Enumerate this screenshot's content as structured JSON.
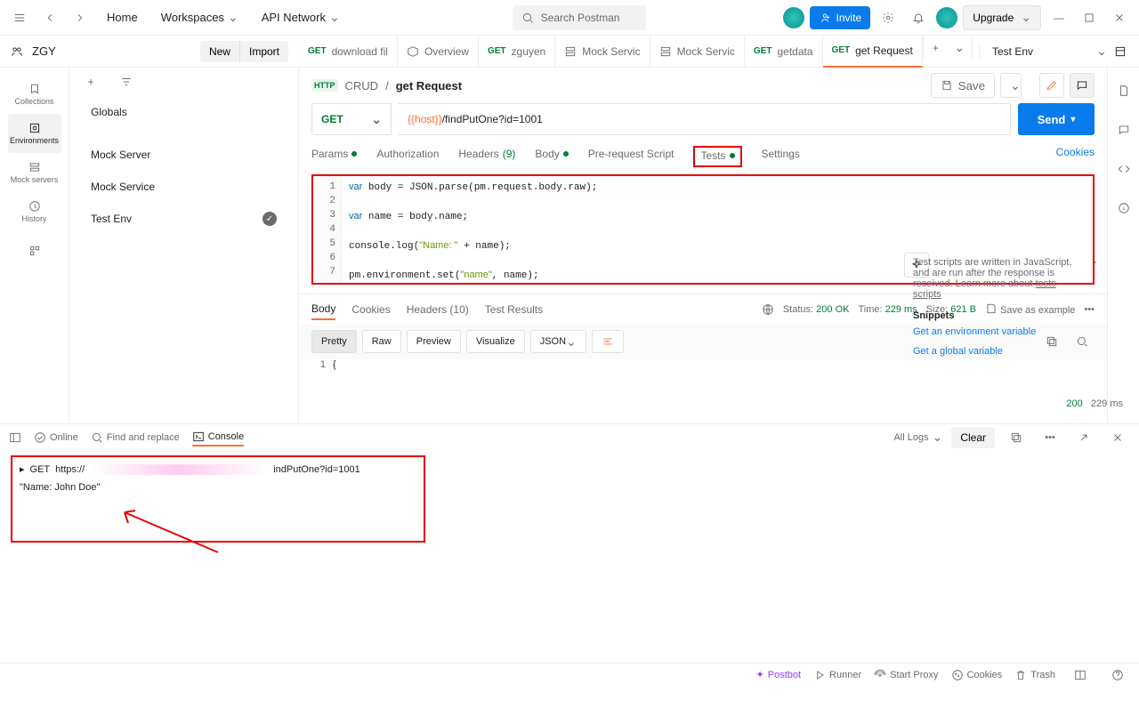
{
  "nav": {
    "home": "Home",
    "workspaces": "Workspaces",
    "apinet": "API Network",
    "search_placeholder": "Search Postman",
    "invite": "Invite",
    "upgrade": "Upgrade"
  },
  "workspace": {
    "name": "ZGY",
    "new": "New",
    "import": "Import",
    "env_label": "Test Env"
  },
  "tabs": [
    {
      "method": "GET",
      "label": "download fil",
      "color": "#007f31"
    },
    {
      "method": "",
      "label": "Overview",
      "color": "#6b6b6b",
      "icon": "folder"
    },
    {
      "method": "GET",
      "label": "zguyen",
      "color": "#007f31"
    },
    {
      "method": "",
      "label": "Mock Servic",
      "icon": "server"
    },
    {
      "method": "",
      "label": "Mock Servic",
      "icon": "server"
    },
    {
      "method": "GET",
      "label": "getdata",
      "color": "#007f31"
    },
    {
      "method": "GET",
      "label": "get Request",
      "color": "#007f31",
      "active": true
    }
  ],
  "rail": {
    "collections": "Collections",
    "environments": "Environments",
    "mock": "Mock servers",
    "history": "History"
  },
  "side": [
    {
      "label": "Globals"
    },
    {
      "label": "Mock Server"
    },
    {
      "label": "Mock Service"
    },
    {
      "label": "Test Env",
      "selected": true,
      "check": true
    }
  ],
  "breadcrumb": {
    "folder": "CRUD",
    "name": "get Request",
    "save": "Save"
  },
  "request": {
    "method": "GET",
    "url_host": "{{host}}",
    "url_path": "/findPutOne?id=1001",
    "send": "Send",
    "tabs": {
      "params": "Params",
      "auth": "Authorization",
      "headers": "Headers",
      "headers_count": "(9)",
      "body": "Body",
      "prescript": "Pre-request Script",
      "tests": "Tests",
      "settings": "Settings",
      "cookies": "Cookies"
    }
  },
  "code_lines": [
    "var body = JSON.parse(pm.request.body.raw);",
    "",
    "var name = body.name;",
    "",
    "console.log(\"Name: \" + name);",
    "",
    "pm.environment.set(\"name\", name);"
  ],
  "snippet": {
    "text": "Test scripts are written in JavaScript, and are run after the response is received. Learn more about",
    "link": "tests scripts",
    "header": "Snippets",
    "s1": "Get an environment variable",
    "s2": "Get a global variable"
  },
  "response": {
    "tabs": {
      "body": "Body",
      "cookies": "Cookies",
      "headers": "Headers",
      "headers_count": "(10)",
      "results": "Test Results"
    },
    "status_label": "Status:",
    "status": "200 OK",
    "time_label": "Time:",
    "time": "229 ms",
    "size_label": "Size:",
    "size": "621 B",
    "save_example": "Save as example",
    "pretty": "Pretty",
    "raw": "Raw",
    "preview": "Preview",
    "visualize": "Visualize",
    "format": "JSON",
    "line1": "{"
  },
  "footer": {
    "online": "Online",
    "find": "Find and replace",
    "console": "Console",
    "all_logs": "All Logs",
    "clear": "Clear"
  },
  "console": {
    "req_method": "GET",
    "req_url_prefix": "https://",
    "req_url_suffix": "indPutOne?id=1001",
    "log": "\"Name: John Doe\"",
    "status": "200",
    "time": "229 ms"
  },
  "bottom": {
    "postbot": "Postbot",
    "runner": "Runner",
    "proxy": "Start Proxy",
    "cookies": "Cookies",
    "trash": "Trash"
  }
}
